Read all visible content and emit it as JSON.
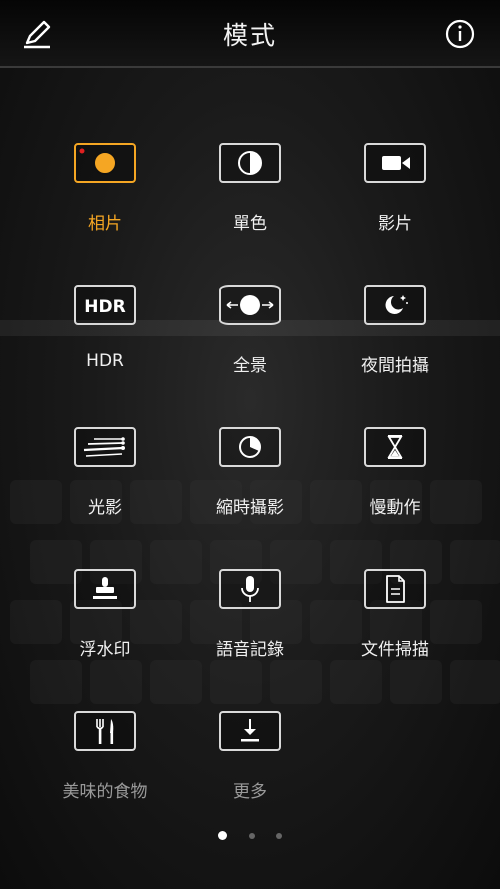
{
  "header": {
    "title": "模式",
    "edit_icon": "pencil-icon",
    "info_icon": "info-icon"
  },
  "modes": [
    {
      "label": "相片",
      "icon": "camera-photo-icon",
      "active": true
    },
    {
      "label": "單色",
      "icon": "monochrome-icon"
    },
    {
      "label": "影片",
      "icon": "video-camera-icon"
    },
    {
      "label": "HDR",
      "icon": "hdr-icon"
    },
    {
      "label": "全景",
      "icon": "panorama-icon"
    },
    {
      "label": "夜間拍攝",
      "icon": "night-moon-icon"
    },
    {
      "label": "光影",
      "icon": "light-trails-icon"
    },
    {
      "label": "縮時攝影",
      "icon": "timelapse-icon"
    },
    {
      "label": "慢動作",
      "icon": "hourglass-icon"
    },
    {
      "label": "浮水印",
      "icon": "stamp-icon"
    },
    {
      "label": "語音記錄",
      "icon": "microphone-icon"
    },
    {
      "label": "文件掃描",
      "icon": "document-scan-icon"
    },
    {
      "label": "美味的食物",
      "icon": "fork-knife-icon"
    },
    {
      "label": "更多",
      "icon": "download-icon"
    }
  ],
  "hdr_tile_text": "HDR",
  "pagination": {
    "pages": 3,
    "current": 1
  },
  "colors": {
    "accent": "#f5a623",
    "tile_border": "#d9d9d9",
    "background": "#1a1a1a"
  }
}
